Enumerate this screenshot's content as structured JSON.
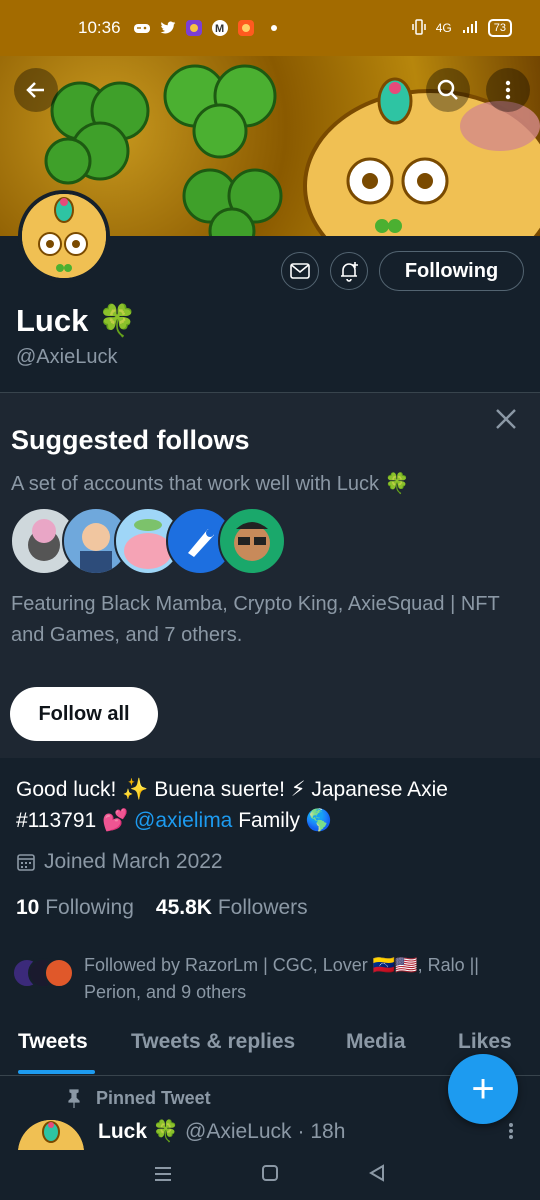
{
  "status_bar": {
    "time": "10:36",
    "signal_label": "4G",
    "battery": "73"
  },
  "profile": {
    "name": "Luck",
    "name_emoji": "🍀",
    "handle": "@AxieLuck",
    "following_button": "Following"
  },
  "suggested": {
    "title": "Suggested follows",
    "subtitle": "A set of accounts that work well with Luck 🍀",
    "featuring": "Featuring Black Mamba, Crypto King, AxieSquad | NFT and Games, and 7 others.",
    "follow_all": "Follow all"
  },
  "bio": {
    "line_prefix": "Good luck! ✨ Buena suerte! ⚡ Japanese Axie #113791 💕 ",
    "mention": "@axielima",
    "line_suffix": " Family 🌎"
  },
  "joined": "Joined March 2022",
  "counts": {
    "following_num": "10",
    "following_label": "Following",
    "followers_num": "45.8K",
    "followers_label": "Followers"
  },
  "followed_by": "Followed by RazorLm | CGC, Lover 🇻🇪🇺🇸, Ralo || Perion, and 9 others",
  "tabs": [
    "Tweets",
    "Tweets & replies",
    "Media",
    "Likes"
  ],
  "pinned_tweet": {
    "pinned_label": "Pinned Tweet",
    "author_name": "Luck 🍀",
    "author_handle": "@AxieLuck",
    "time": "· 18h"
  },
  "fab_label": "+",
  "colors": {
    "accent": "#1d9bf0",
    "background": "#15202b",
    "status_bar": "#a36b00"
  }
}
